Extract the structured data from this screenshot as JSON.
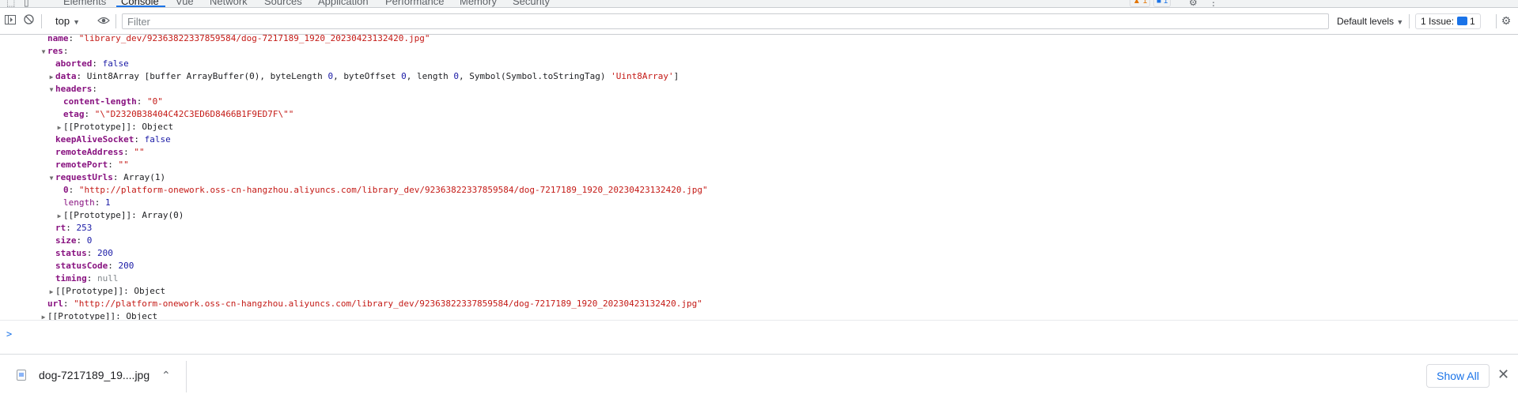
{
  "devtools": {
    "tabs": [
      "Elements",
      "Console",
      "Vue",
      "Network",
      "Sources",
      "Application",
      "Performance",
      "Memory",
      "Security"
    ],
    "selected_tab": "Console",
    "warning_count": "1",
    "message_count": "1"
  },
  "toolbar": {
    "context": "top",
    "filter_placeholder": "Filter",
    "levels_label": "Default levels",
    "issues_label": "1 Issue:",
    "issues_count": "1"
  },
  "console_lines": [
    {
      "indent": 0,
      "tri": "",
      "key": "name",
      "bold": true,
      "val": "\"library_dev/92363822337859584/dog-7217189_1920_20230423132420.jpg\"",
      "vtype": "str"
    },
    {
      "indent": 0,
      "tri": "down",
      "key": "res",
      "bold": true,
      "val": "",
      "vtype": "p"
    },
    {
      "indent": 1,
      "tri": "",
      "key": "aborted",
      "bold": true,
      "val": "false",
      "vtype": "bool"
    },
    {
      "indent": 1,
      "tri": "right",
      "key": "data",
      "bold": true,
      "rich": "data"
    },
    {
      "indent": 1,
      "tri": "down",
      "key": "headers",
      "bold": true,
      "val": "",
      "vtype": "p"
    },
    {
      "indent": 2,
      "tri": "",
      "key": "content-length",
      "bold": true,
      "val": "\"0\"",
      "vtype": "str"
    },
    {
      "indent": 2,
      "tri": "",
      "key": "etag",
      "bold": true,
      "val": "\"\\\"D2320B38404C42C3ED6D8466B1F9ED7F\\\"\"",
      "vtype": "str"
    },
    {
      "indent": 2,
      "tri": "right",
      "key": "[[Prototype]]",
      "bold": false,
      "val": "Object",
      "vtype": "p"
    },
    {
      "indent": 1,
      "tri": "",
      "key": "keepAliveSocket",
      "bold": true,
      "val": "false",
      "vtype": "bool"
    },
    {
      "indent": 1,
      "tri": "",
      "key": "remoteAddress",
      "bold": true,
      "val": "\"\"",
      "vtype": "str"
    },
    {
      "indent": 1,
      "tri": "",
      "key": "remotePort",
      "bold": true,
      "val": "\"\"",
      "vtype": "str"
    },
    {
      "indent": 1,
      "tri": "down",
      "key": "requestUrls",
      "bold": true,
      "val": "Array(1)",
      "vtype": "p"
    },
    {
      "indent": 2,
      "tri": "",
      "key": "0",
      "bold": true,
      "val": "\"http://platform-onework.oss-cn-hangzhou.aliyuncs.com/library_dev/92363822337859584/dog-7217189_1920_20230423132420.jpg\"",
      "vtype": "str"
    },
    {
      "indent": 2,
      "tri": "",
      "key": "length",
      "bold": false,
      "val": "1",
      "vtype": "num"
    },
    {
      "indent": 2,
      "tri": "right",
      "key": "[[Prototype]]",
      "bold": false,
      "val": "Array(0)",
      "vtype": "p"
    },
    {
      "indent": 1,
      "tri": "",
      "key": "rt",
      "bold": true,
      "val": "253",
      "vtype": "num"
    },
    {
      "indent": 1,
      "tri": "",
      "key": "size",
      "bold": true,
      "val": "0",
      "vtype": "num"
    },
    {
      "indent": 1,
      "tri": "",
      "key": "status",
      "bold": true,
      "val": "200",
      "vtype": "num"
    },
    {
      "indent": 1,
      "tri": "",
      "key": "statusCode",
      "bold": true,
      "val": "200",
      "vtype": "num"
    },
    {
      "indent": 1,
      "tri": "",
      "key": "timing",
      "bold": true,
      "val": "null",
      "vtype": "nul"
    },
    {
      "indent": 1,
      "tri": "right",
      "key": "[[Prototype]]",
      "bold": false,
      "val": "Object",
      "vtype": "p"
    },
    {
      "indent": 0,
      "tri": "",
      "key": "url",
      "bold": true,
      "val": "\"http://platform-onework.oss-cn-hangzhou.aliyuncs.com/library_dev/92363822337859584/dog-7217189_1920_20230423132420.jpg\"",
      "vtype": "str"
    },
    {
      "indent": 0,
      "tri": "right",
      "key": "[[Prototype]]",
      "bold": false,
      "val": "Object",
      "vtype": "p"
    }
  ],
  "data_line": {
    "type": "Uint8Array",
    "buffer_key": "buffer",
    "buffer_val": "ArrayBuffer(0)",
    "bytelength_key": "byteLength",
    "bytelength_val": "0",
    "byteoffset_key": "byteOffset",
    "byteoffset_val": "0",
    "length_key": "length",
    "length_val": "0",
    "symbol_key": "Symbol(Symbol.toStringTag)",
    "symbol_val": "'Uint8Array'"
  },
  "prompt_symbol": ">",
  "download_shelf": {
    "file_name": "dog-7217189_19....jpg",
    "show_all_label": "Show All"
  },
  "icons": {
    "inspect": "inspect-icon",
    "device": "device-toolbar-icon",
    "sidebar": "sidebar-toggle-icon",
    "clear": "clear-console-icon",
    "eye": "eye-icon",
    "settings": "gear-icon",
    "more": "kebab-menu-icon"
  }
}
